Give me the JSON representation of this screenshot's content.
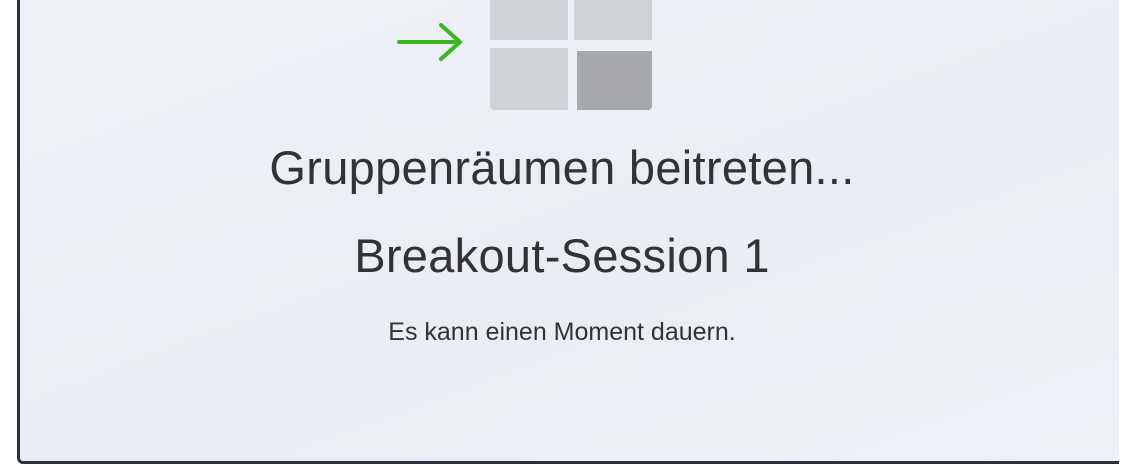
{
  "icons": {
    "arrow": "arrow-right-icon",
    "rooms": "breakout-rooms-icon"
  },
  "colors": {
    "arrow": "#3ab71e",
    "panel_background": "#ecf0f5",
    "text": "#333333",
    "tile_light": "#cfd2d6",
    "tile_dark": "#a7a9ac"
  },
  "dialog": {
    "title": "Gruppenräumen beitreten...",
    "session_name": "Breakout-Session 1",
    "message": "Es kann einen Moment dauern."
  }
}
